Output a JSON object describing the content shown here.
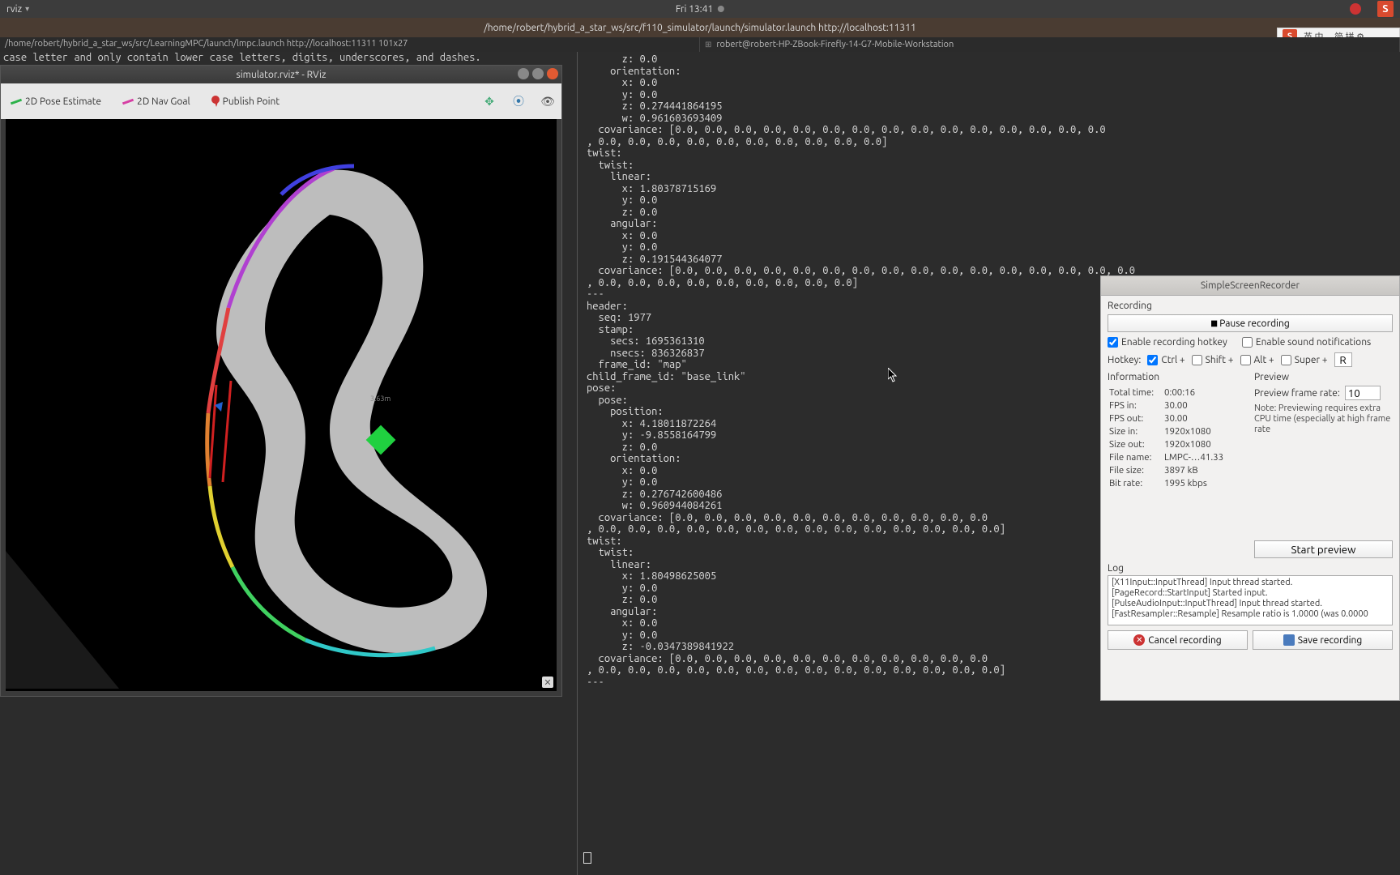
{
  "menubar": {
    "app": "rviz",
    "clock": "Fri 13:41"
  },
  "ime": {
    "items": "英 中 ，简 拼 ⚙"
  },
  "term": {
    "title": "/home/robert/hybrid_a_star_ws/src/f110_simulator/launch/simulator.launch http://localhost:11311",
    "tab_left": "/home/robert/hybrid_a_star_ws/src/LearningMPC/launch/lmpc.launch http://localhost:11311 101x27",
    "tab_right": "robert@robert-HP-ZBook-Firefly-14-G7-Mobile-Workstation",
    "line1": "case letter and only contain lower case letters, digits, underscores, and dashes.",
    "output": "      z: 0.0\n    orientation:\n      x: 0.0\n      y: 0.0\n      z: 0.274441864195\n      w: 0.961603693409\n  covariance: [0.0, 0.0, 0.0, 0.0, 0.0, 0.0, 0.0, 0.0, 0.0, 0.0, 0.0, 0.0, 0.0, 0.0, 0.0\n, 0.0, 0.0, 0.0, 0.0, 0.0, 0.0, 0.0, 0.0, 0.0, 0.0]\ntwist:\n  twist:\n    linear:\n      x: 1.80378715169\n      y: 0.0\n      z: 0.0\n    angular:\n      x: 0.0\n      y: 0.0\n      z: 0.191544364077\n  covariance: [0.0, 0.0, 0.0, 0.0, 0.0, 0.0, 0.0, 0.0, 0.0, 0.0, 0.0, 0.0, 0.0, 0.0, 0.0, 0.0\n, 0.0, 0.0, 0.0, 0.0, 0.0, 0.0, 0.0, 0.0, 0.0]\n---\nheader:\n  seq: 1977\n  stamp:\n    secs: 1695361310\n    nsecs: 836326837\n  frame_id: \"map\"\nchild_frame_id: \"base_link\"\npose:\n  pose:\n    position:\n      x: 4.18011872264\n      y: -9.8558164799\n      z: 0.0\n    orientation:\n      x: 0.0\n      y: 0.0\n      z: 0.276742600486\n      w: 0.960944084261\n  covariance: [0.0, 0.0, 0.0, 0.0, 0.0, 0.0, 0.0, 0.0, 0.0, 0.0, 0.0\n, 0.0, 0.0, 0.0, 0.0, 0.0, 0.0, 0.0, 0.0, 0.0, 0.0, 0.0, 0.0, 0.0, 0.0]\ntwist:\n  twist:\n    linear:\n      x: 1.80498625005\n      y: 0.0\n      z: 0.0\n    angular:\n      x: 0.0\n      y: 0.0\n      z: -0.0347389841922\n  covariance: [0.0, 0.0, 0.0, 0.0, 0.0, 0.0, 0.0, 0.0, 0.0, 0.0, 0.0\n, 0.0, 0.0, 0.0, 0.0, 0.0, 0.0, 0.0, 0.0, 0.0, 0.0, 0.0, 0.0, 0.0, 0.0]\n---"
  },
  "rviz": {
    "title": "simulator.rviz* - RViz",
    "tools": {
      "pose_estimate": "2D Pose Estimate",
      "nav_goal": "2D Nav Goal",
      "publish_point": "Publish Point"
    }
  },
  "ssr": {
    "title": "SimpleScreenRecorder",
    "section_recording": "Recording",
    "pause": "Pause recording",
    "enable_hotkey": "Enable recording hotkey",
    "enable_sound": "Enable sound notifications",
    "hotkey_label": "Hotkey:",
    "mods": {
      "ctrl": "Ctrl +",
      "shift": "Shift +",
      "alt": "Alt +",
      "super": "Super +"
    },
    "key": "R",
    "section_info": "Information",
    "section_preview": "Preview",
    "info": {
      "total_time_l": "Total time:",
      "total_time": "0:00:16",
      "fps_in_l": "FPS in:",
      "fps_in": "30.00",
      "fps_out_l": "FPS out:",
      "fps_out": "30.00",
      "size_in_l": "Size in:",
      "size_in": "1920x1080",
      "size_out_l": "Size out:",
      "size_out": "1920x1080",
      "file_name_l": "File name:",
      "file_name": "LMPC-…41.33",
      "file_size_l": "File size:",
      "file_size": "3897 kB",
      "bit_rate_l": "Bit rate:",
      "bit_rate": "1995 kbps"
    },
    "preview_rate_l": "Preview frame rate:",
    "preview_rate": "10",
    "preview_note": "Note: Previewing requires extra CPU time (especially at high frame rate",
    "start_preview": "Start preview",
    "section_log": "Log",
    "log": [
      "[X11Input::InputThread] Input thread started.",
      "[PageRecord::StartInput] Started input.",
      "[PulseAudioInput::InputThread] Input thread started.",
      "[FastResampler::Resample] Resample ratio is 1.0000 (was 0.0000"
    ],
    "cancel": "Cancel recording",
    "save": "Save recording"
  }
}
